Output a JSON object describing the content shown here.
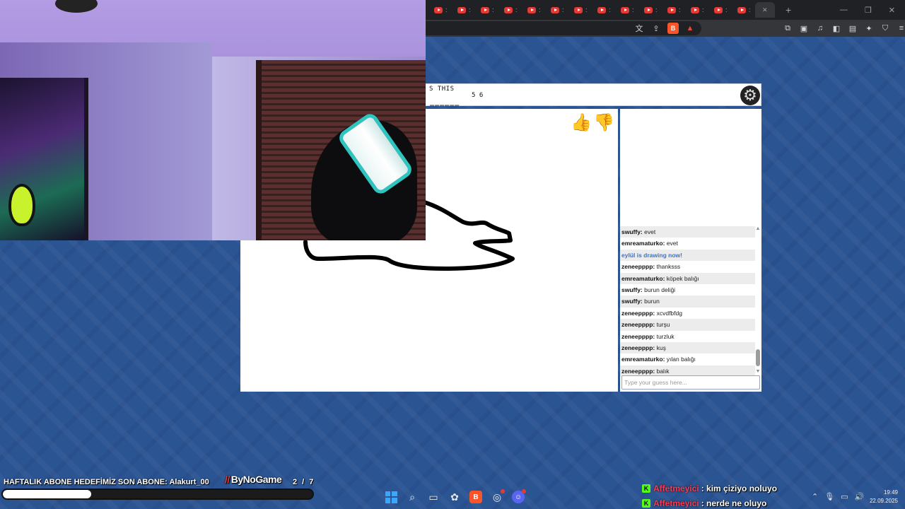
{
  "browser": {
    "tab_count_youtube": 14,
    "new_tab_symbol": "+",
    "window_controls": [
      "—",
      "❐",
      "✕"
    ]
  },
  "game": {
    "hint_label": "S THIS",
    "word_lengths": "5 6",
    "word_blanks": "______",
    "settings_icon": "gear-icon",
    "vote_like_icon": "thumbs-up-icon",
    "vote_dislike_icon": "thumbs-down-icon"
  },
  "chat": {
    "messages": [
      {
        "user": "swuffy",
        "text": "evet"
      },
      {
        "user": "emreamaturko",
        "text": "evet"
      },
      {
        "user": "",
        "text": "eylül is drawing now!",
        "system": true
      },
      {
        "user": "zeneepppp",
        "text": "thanksss"
      },
      {
        "user": "emreamaturko",
        "text": "köpek balığı"
      },
      {
        "user": "swuffy",
        "text": "burun deliği"
      },
      {
        "user": "swuffy",
        "text": "burun"
      },
      {
        "user": "zeneepppp",
        "text": "xcvdfbfdg"
      },
      {
        "user": "zeneepppp",
        "text": "turşu"
      },
      {
        "user": "zeneepppp",
        "text": "turzluk"
      },
      {
        "user": "zeneepppp",
        "text": "kuş"
      },
      {
        "user": "emreamaturko",
        "text": "yılan balığı"
      },
      {
        "user": "zeneepppp",
        "text": "balık"
      }
    ],
    "input_placeholder": "Type your guess here..."
  },
  "overlay": {
    "goal_text": "HAFTALIK ABONE HEDEFİMİZ SON ABONE: Alakurt_00",
    "brand": "ByNoGame",
    "goal_count": "2 / 7",
    "goal_progress": 0.2857,
    "twitch_chat": [
      {
        "user": "Affetmeyici",
        "text": ": kim çiziyo noluyo"
      },
      {
        "user": "Affetmeyici",
        "text": ": nerde ne oluyo"
      }
    ]
  },
  "taskbar": {
    "time": "19:49",
    "date": "22.09.2025"
  },
  "colors": {
    "background": "#2b5493",
    "system_message": "#3f72c2",
    "twitch_user": "#ff3b4f",
    "kick_badge": "#53fc18"
  }
}
